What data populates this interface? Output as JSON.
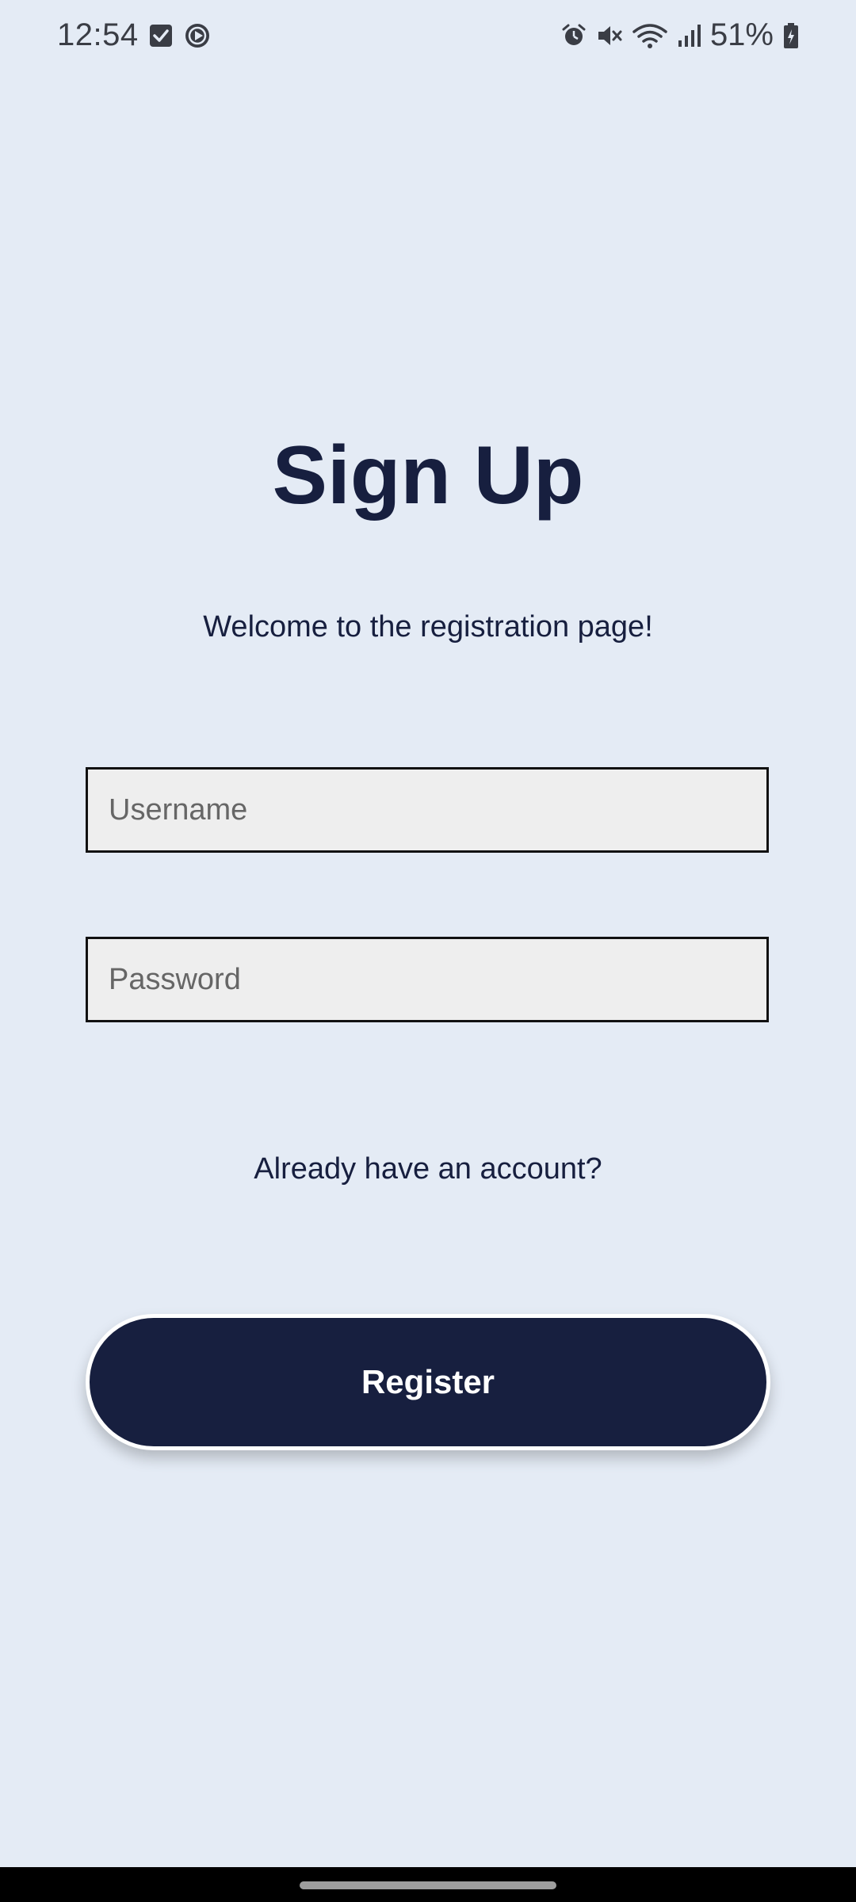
{
  "status_bar": {
    "time": "12:54",
    "battery": "51%",
    "left_icons": [
      "checkbox-notification-icon",
      "media-play-icon"
    ],
    "right_icons": [
      "alarm-icon",
      "mute-icon",
      "wifi-icon",
      "signal-icon",
      "battery-icon"
    ]
  },
  "page": {
    "title": "Sign Up",
    "welcome": "Welcome to the registration page!"
  },
  "form": {
    "username_placeholder": "Username",
    "username_value": "",
    "password_placeholder": "Password",
    "password_value": "",
    "account_link": "Already have an account?",
    "register_label": "Register"
  },
  "colors": {
    "background": "#e4ebf5",
    "primary": "#171f3f",
    "input_bg": "#eeeeee",
    "button_text": "#ffffff"
  }
}
